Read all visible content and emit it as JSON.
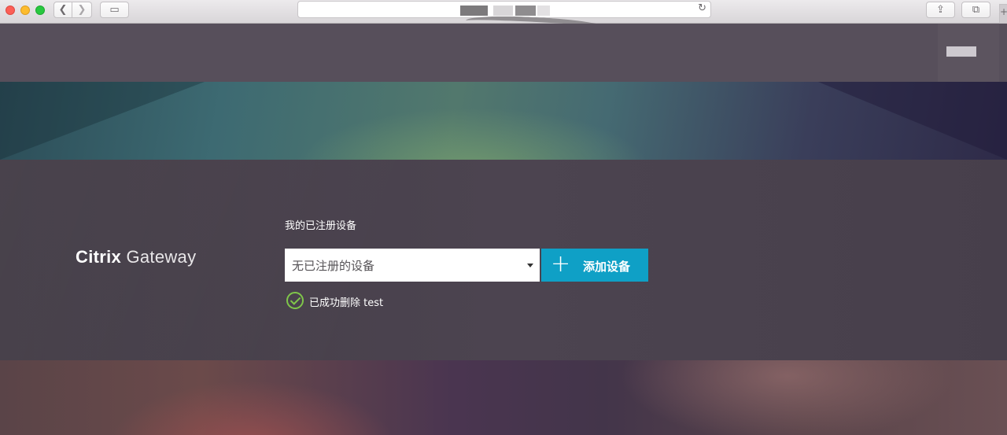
{
  "browser": {
    "back_glyph": "❮",
    "forward_glyph": "❯",
    "sidebar_glyph": "▭",
    "reload_glyph": "↻",
    "share_glyph": "⇪",
    "tabs_glyph": "⧉",
    "newtab_glyph": "+",
    "icons": [
      "back-icon",
      "forward-icon",
      "sidebar-icon",
      "reload-icon",
      "share-icon",
      "tabs-icon",
      "new-tab-icon"
    ]
  },
  "brand": {
    "name_bold": "Citrix",
    "name_light": "Gateway"
  },
  "devices": {
    "section_title": "我的已注册设备",
    "select_value": "无已注册的设备",
    "add_button_icon": "+",
    "add_button_label": "添加设备"
  },
  "status": {
    "icon": "check-circle-icon",
    "message": "已成功删除 test",
    "color": "#7fc64a"
  },
  "colors": {
    "accent": "#0fa0c6",
    "panel": "#4a4250",
    "top_band": "#574f5b"
  }
}
